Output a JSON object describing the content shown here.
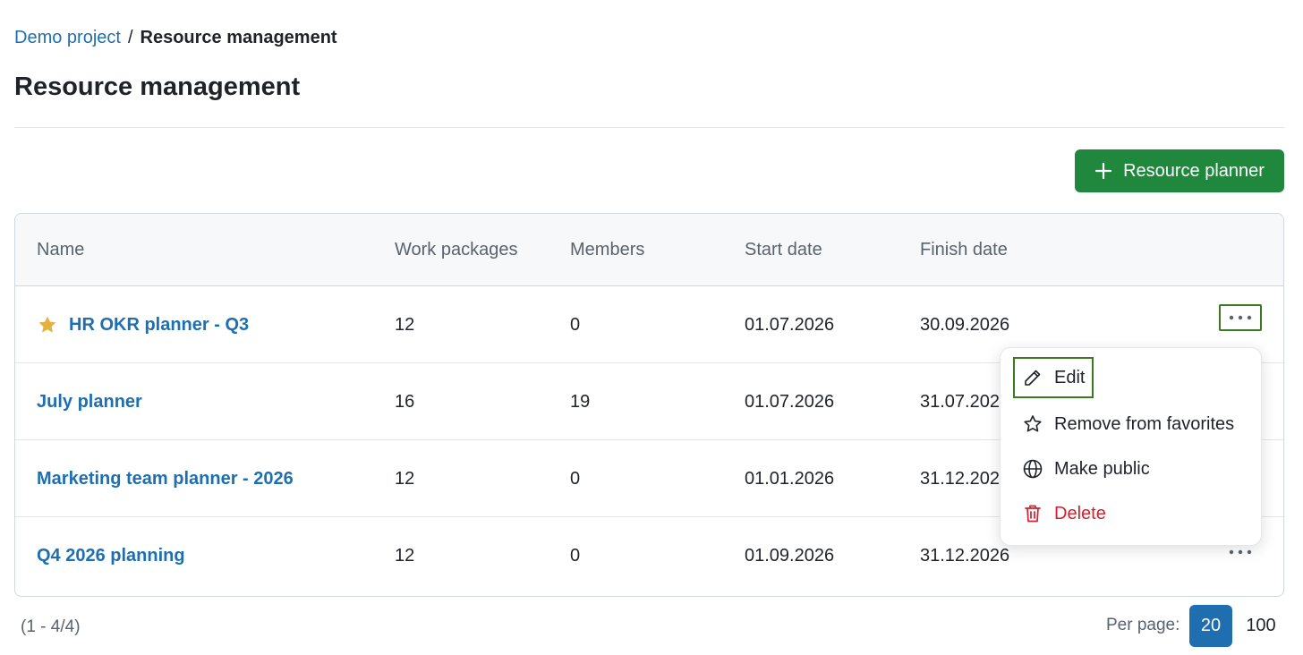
{
  "breadcrumb": {
    "project": "Demo project",
    "separator": "/",
    "current": "Resource management"
  },
  "page_title": "Resource management",
  "create_button": {
    "icon": "plus-icon",
    "label": "Resource planner"
  },
  "table": {
    "headers": [
      "Name",
      "Work packages",
      "Members",
      "Start date",
      "Finish date"
    ],
    "rows": [
      {
        "name": "HR OKR planner - Q3",
        "favorite": true,
        "work_packages": "12",
        "members": "0",
        "start": "01.07.2026",
        "finish": "30.09.2026"
      },
      {
        "name": "July planner",
        "favorite": false,
        "work_packages": "16",
        "members": "19",
        "start": "01.07.2026",
        "finish": "31.07.2026"
      },
      {
        "name": "Marketing team planner - 2026",
        "favorite": false,
        "work_packages": "12",
        "members": "0",
        "start": "01.01.2026",
        "finish": "31.12.2026"
      },
      {
        "name": "Q4 2026 planning",
        "favorite": false,
        "work_packages": "12",
        "members": "0",
        "start": "01.09.2026",
        "finish": "31.12.2026"
      }
    ]
  },
  "context_menu": {
    "items": [
      {
        "label": "Edit",
        "icon": "pencil-icon"
      },
      {
        "label": "Remove from favorites",
        "icon": "star-outline-icon"
      },
      {
        "label": "Make public",
        "icon": "globe-icon"
      },
      {
        "label": "Delete",
        "icon": "trash-icon"
      }
    ]
  },
  "pagination": {
    "count": "(1 - 4/4)",
    "per_page_label": "Per page:",
    "options": [
      "20",
      "100"
    ],
    "selected": "20"
  },
  "colors": {
    "link": "#1f6fb0",
    "primary": "#1f883d",
    "danger": "#cf222e",
    "favorite_star": "#e3b341",
    "focus_outline": "#3b7a1f"
  }
}
